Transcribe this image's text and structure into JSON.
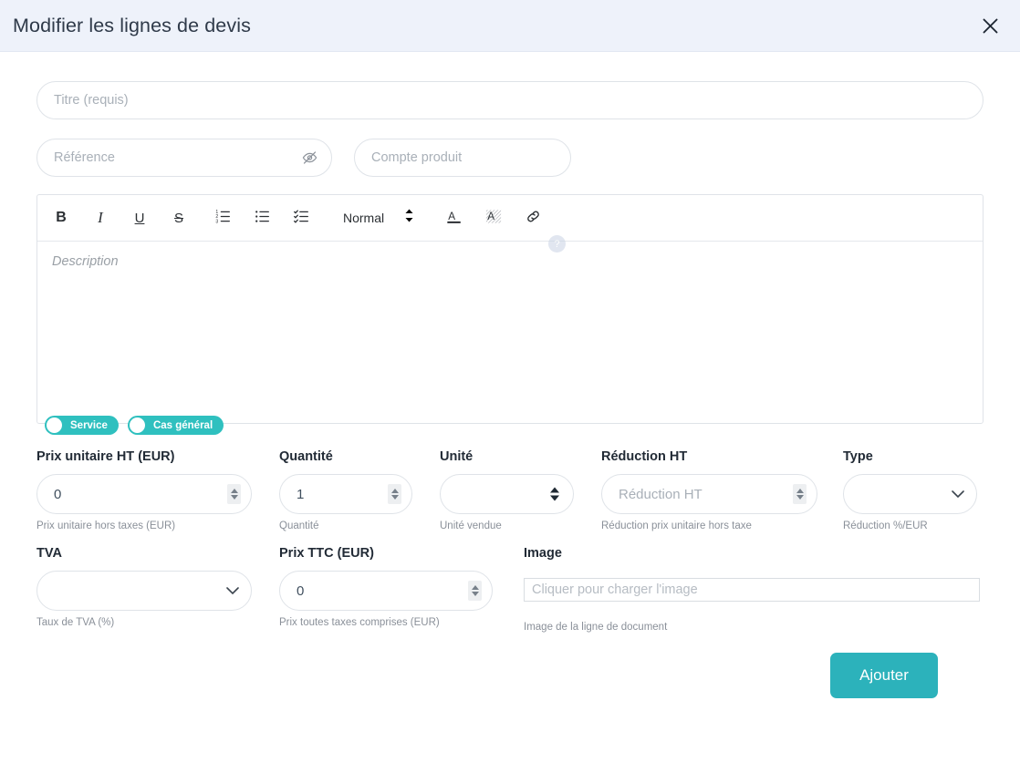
{
  "header": {
    "title": "Modifier les lignes de devis",
    "close_icon": "close-icon"
  },
  "form": {
    "title_field": {
      "placeholder": "Titre (requis)",
      "value": ""
    },
    "reference_field": {
      "placeholder": "Référence",
      "value": "",
      "icon": "eye-slash-icon"
    },
    "compte_produit_field": {
      "placeholder": "Compte produit",
      "value": ""
    },
    "help_badge": "?"
  },
  "editor": {
    "toolbar": {
      "bold": "B",
      "italic": "I",
      "underline": "U",
      "strikethrough": "S",
      "ordered_list": "ordered-list-icon",
      "bullet_list": "bullet-list-icon",
      "check_list": "check-list-icon",
      "format": "Normal",
      "text_color": "text-color-icon",
      "highlight": "highlight-icon",
      "link": "link-icon"
    },
    "placeholder": "Description",
    "content": ""
  },
  "toggles": [
    {
      "label": "Service",
      "on": false
    },
    {
      "label": "Cas général",
      "on": false
    }
  ],
  "fields": {
    "prix_unitaire": {
      "label": "Prix unitaire HT (EUR)",
      "value": "0",
      "hint": "Prix unitaire hors taxes (EUR)"
    },
    "quantite": {
      "label": "Quantité",
      "value": "1",
      "hint": "Quantité"
    },
    "unite": {
      "label": "Unité",
      "value": "",
      "hint": "Unité vendue",
      "options": [
        ""
      ]
    },
    "reduction_ht": {
      "label": "Réduction HT",
      "value": "",
      "placeholder": "Réduction HT",
      "hint": "Réduction prix unitaire hors taxe"
    },
    "type": {
      "label": "Type",
      "value": "",
      "hint": "Réduction %/EUR",
      "options": [
        ""
      ]
    },
    "tva": {
      "label": "TVA",
      "value": "",
      "hint": "Taux de TVA (%)",
      "options": [
        ""
      ]
    },
    "prix_ttc": {
      "label": "Prix TTC (EUR)",
      "value": "0",
      "hint": "Prix toutes taxes comprises (EUR)"
    },
    "image": {
      "label": "Image",
      "value": "",
      "placeholder": "Cliquer pour charger l'image",
      "hint": "Image de la ligne de document"
    }
  },
  "footer": {
    "submit_label": "Ajouter"
  },
  "colors": {
    "accent": "#2cb2bb",
    "toggle": "#2fc0bf",
    "header_bg": "#eef2fa"
  }
}
